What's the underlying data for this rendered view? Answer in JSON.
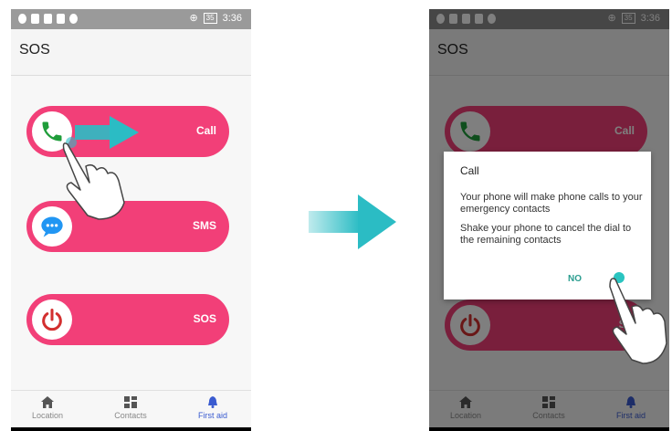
{
  "left_screen": {
    "status_time": "3:36",
    "battery": "35",
    "title": "SOS",
    "buttons": [
      {
        "label": "Call",
        "icon": "phone-icon"
      },
      {
        "label": "SMS",
        "icon": "chat-icon"
      },
      {
        "label": "SOS",
        "icon": "power-icon"
      }
    ],
    "nav": [
      {
        "label": "Location",
        "icon": "home-icon"
      },
      {
        "label": "Contacts",
        "icon": "grid-icon"
      },
      {
        "label": "First aid",
        "icon": "bell-icon",
        "active": true
      }
    ]
  },
  "right_screen": {
    "status_time": "3:36",
    "battery": "35",
    "title": "SOS",
    "button_labels": {
      "call": "Call",
      "sos": "SO"
    },
    "dialog": {
      "title": "Call",
      "body1": "Your phone will make phone calls to your emergency contacts",
      "body2": "Shake your phone to cancel the dial to the remaining contacts",
      "no_label": "NO"
    },
    "nav": [
      {
        "label": "Location"
      },
      {
        "label": "Contacts"
      },
      {
        "label": "First aid"
      }
    ]
  },
  "colors": {
    "button_pink": "#f23f78",
    "arrow_teal": "#2bbcc4",
    "active_nav": "#3a5bd0"
  }
}
